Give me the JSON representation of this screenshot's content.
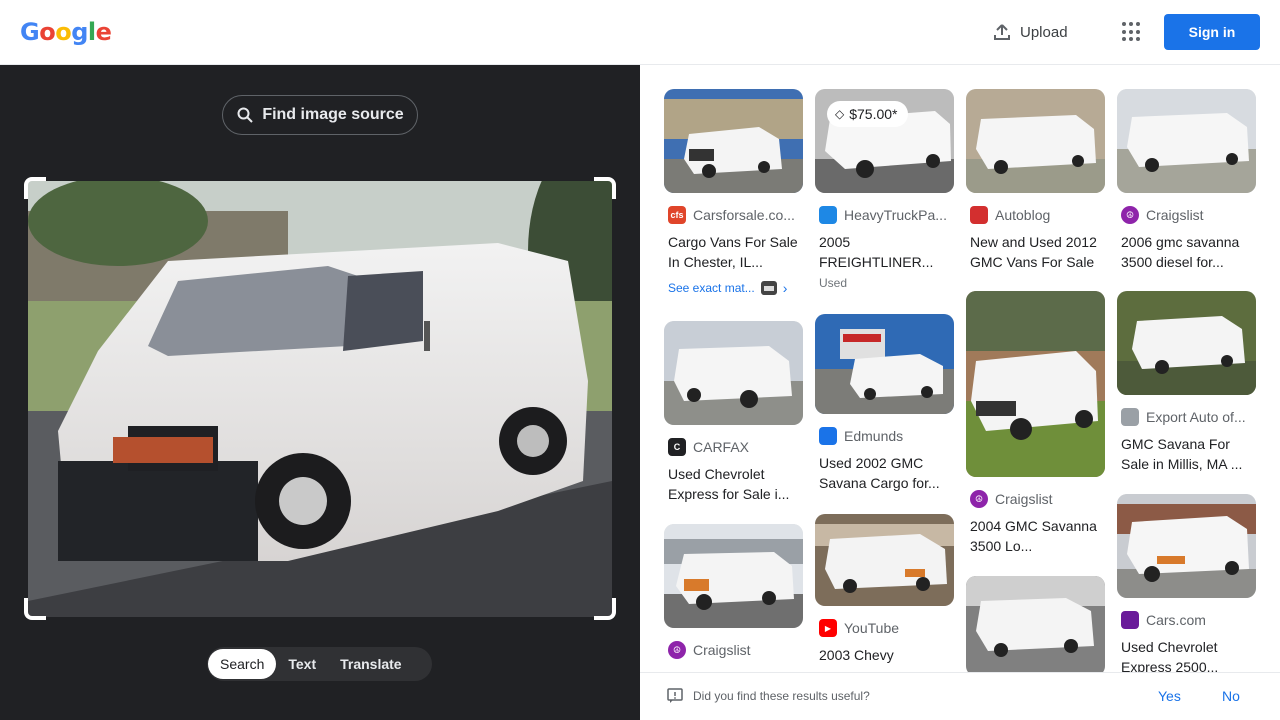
{
  "header": {
    "logo_letters": [
      {
        "ch": "G",
        "color": "#4285f4"
      },
      {
        "ch": "o",
        "color": "#ea4335"
      },
      {
        "ch": "o",
        "color": "#fbbc05"
      },
      {
        "ch": "g",
        "color": "#4285f4"
      },
      {
        "ch": "l",
        "color": "#34a853"
      },
      {
        "ch": "e",
        "color": "#ea4335"
      }
    ],
    "upload_label": "Upload",
    "apps_icon": "apps-grid-icon",
    "signin_label": "Sign in",
    "accent": "#1a73e8"
  },
  "left_panel": {
    "find_source_label": "Find image source",
    "modes": [
      "Search",
      "Text",
      "Translate"
    ],
    "active_mode": "Search"
  },
  "results": [
    {
      "source": "Carsforsale.co...",
      "favicon": "cfs",
      "favicon_color": "#e0452a",
      "title": "Cargo Vans For Sale In Chester, IL...",
      "exact_label": "See exact mat..."
    },
    {
      "source": "HeavyTruckPa...",
      "favicon": "",
      "favicon_color": "#1e88e5",
      "title": "2005 FREIGHTLINER...",
      "price": "$75.00*",
      "sub": "Used"
    },
    {
      "source": "Autoblog",
      "favicon": "",
      "favicon_color": "#d32f2f",
      "title": "New and Used 2012 GMC Vans For Sale"
    },
    {
      "source": "Craigslist",
      "favicon": "☮",
      "favicon_color": "#8e24aa",
      "title": "2006 gmc savanna 3500 diesel for..."
    },
    {
      "source": "CARFAX",
      "favicon": "C",
      "favicon_color": "#202124",
      "title": "Used Chevrolet Express for Sale i..."
    },
    {
      "source": "Edmunds",
      "favicon": "",
      "favicon_color": "#1a73e8",
      "title": "Used 2002 GMC Savana Cargo for..."
    },
    {
      "source": "Craigslist",
      "favicon": "☮",
      "favicon_color": "#8e24aa",
      "title": "2004 GMC Savanna 3500 Lo..."
    },
    {
      "source": "Export Auto of...",
      "favicon": "",
      "favicon_color": "#9aa0a6",
      "title": "GMC Savana For Sale in Millis, MA ..."
    },
    {
      "source": "Craigslist",
      "favicon": "☮",
      "favicon_color": "#8e24aa",
      "title": ""
    },
    {
      "source": "YouTube",
      "favicon": "▶",
      "favicon_color": "#ff0000",
      "title": "2003 Chevy"
    },
    {
      "source": "",
      "favicon": "",
      "favicon_color": "",
      "title": ""
    },
    {
      "source": "Cars.com",
      "favicon": "",
      "favicon_color": "#6a1b9a",
      "title": "Used Chevrolet Express 2500..."
    }
  ],
  "feedback": {
    "question": "Did you find these results useful?",
    "yes": "Yes",
    "no": "No"
  }
}
